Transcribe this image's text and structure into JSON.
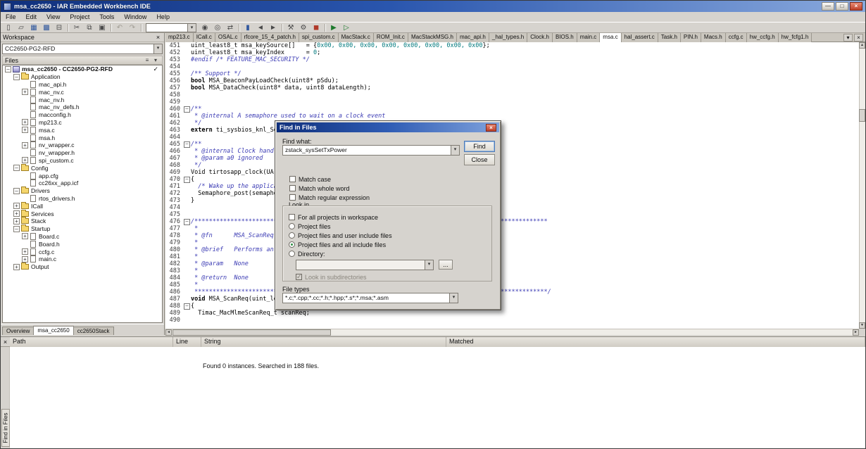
{
  "window": {
    "title": "msa_cc2650 - IAR Embedded Workbench IDE",
    "controls": {
      "minimize": "—",
      "maximize": "□",
      "close": "×"
    }
  },
  "icons": {
    "combo_arrow": "▾",
    "check": "✓",
    "up": "▲",
    "down": "▼",
    "left": "◄",
    "right": "►"
  },
  "menu": {
    "items": [
      "File",
      "Edit",
      "View",
      "Project",
      "Tools",
      "Window",
      "Help"
    ]
  },
  "toolbar": [
    {
      "name": "new-document-icon",
      "glyph": "▯"
    },
    {
      "name": "open-document-icon",
      "glyph": "▱"
    },
    {
      "name": "save-icon",
      "glyph": "▦",
      "cls": "blue"
    },
    {
      "name": "save-all-icon",
      "glyph": "▩",
      "cls": "blue"
    },
    {
      "name": "print-icon",
      "glyph": "⊟"
    },
    {
      "sep": true
    },
    {
      "name": "cut-icon",
      "glyph": "✂"
    },
    {
      "name": "copy-icon",
      "glyph": "⧉"
    },
    {
      "name": "paste-icon",
      "glyph": "▣"
    },
    {
      "sep": true
    },
    {
      "name": "undo-icon",
      "glyph": "↶",
      "cls": "dis"
    },
    {
      "name": "redo-icon",
      "glyph": "↷",
      "cls": "dis"
    },
    {
      "sep": true
    },
    {
      "combo": true,
      "name": "quick-search-combo"
    },
    {
      "name": "find-icon",
      "glyph": "◉"
    },
    {
      "name": "find-next-icon",
      "glyph": "◎"
    },
    {
      "name": "replace-icon",
      "glyph": "⇄"
    },
    {
      "sep": true
    },
    {
      "name": "toggle-bookmark-icon",
      "glyph": "▮",
      "cls": "blue"
    },
    {
      "name": "previous-bookmark-icon",
      "glyph": "◄"
    },
    {
      "name": "next-bookmark-icon",
      "glyph": "►"
    },
    {
      "sep": true
    },
    {
      "name": "make-icon",
      "glyph": "⚒"
    },
    {
      "name": "compile-icon",
      "glyph": "⚙"
    },
    {
      "name": "stop-build-icon",
      "glyph": "◼",
      "cls": "red"
    },
    {
      "sep": true
    },
    {
      "name": "download-and-debug-icon",
      "glyph": "▶",
      "cls": "green"
    },
    {
      "name": "debug-without-downloading-icon",
      "glyph": "▷",
      "cls": "green"
    }
  ],
  "workspace": {
    "title": "Workspace",
    "close_button": "×",
    "config_selector": "CC2650-PG2-RFD",
    "files_header": "Files",
    "files_buttons": [
      {
        "name": "files-sort-icon",
        "glyph": "≡"
      },
      {
        "name": "files-columns-icon",
        "glyph": "▾"
      }
    ],
    "tree": [
      {
        "label": "msa_cc2650 - CC2650-PG2-RFD",
        "depth": 0,
        "kind": "project",
        "exp": "-",
        "check": true
      },
      {
        "label": "Application",
        "depth": 1,
        "kind": "folder",
        "exp": "-"
      },
      {
        "label": "mac_api.h",
        "depth": 2,
        "kind": "file"
      },
      {
        "label": "mac_nv.c",
        "depth": 2,
        "kind": "file",
        "exp": "+"
      },
      {
        "label": "mac_nv.h",
        "depth": 2,
        "kind": "file"
      },
      {
        "label": "mac_nv_defs.h",
        "depth": 2,
        "kind": "file"
      },
      {
        "label": "macconfig.h",
        "depth": 2,
        "kind": "file"
      },
      {
        "label": "mp213.c",
        "depth": 2,
        "kind": "file",
        "exp": "+"
      },
      {
        "label": "msa.c",
        "depth": 2,
        "kind": "file",
        "exp": "+"
      },
      {
        "label": "msa.h",
        "depth": 2,
        "kind": "file"
      },
      {
        "label": "nv_wrapper.c",
        "depth": 2,
        "kind": "file",
        "exp": "+"
      },
      {
        "label": "nv_wrapper.h",
        "depth": 2,
        "kind": "file"
      },
      {
        "label": "spi_custom.c",
        "depth": 2,
        "kind": "file",
        "exp": "+"
      },
      {
        "label": "Config",
        "depth": 1,
        "kind": "folder",
        "exp": "-"
      },
      {
        "label": "app.cfg",
        "depth": 2,
        "kind": "file"
      },
      {
        "label": "cc26xx_app.icf",
        "depth": 2,
        "kind": "file"
      },
      {
        "label": "Drivers",
        "depth": 1,
        "kind": "folder",
        "exp": "-"
      },
      {
        "label": "rtos_drivers.h",
        "depth": 2,
        "kind": "file"
      },
      {
        "label": "ICall",
        "depth": 1,
        "kind": "folder",
        "exp": "+"
      },
      {
        "label": "Services",
        "depth": 1,
        "kind": "folder",
        "exp": "+"
      },
      {
        "label": "Stack",
        "depth": 1,
        "kind": "folder",
        "exp": "+"
      },
      {
        "label": "Startup",
        "depth": 1,
        "kind": "folder",
        "exp": "-"
      },
      {
        "label": "Board.c",
        "depth": 2,
        "kind": "file",
        "exp": "+"
      },
      {
        "label": "Board.h",
        "depth": 2,
        "kind": "file"
      },
      {
        "label": "ccfg.c",
        "depth": 2,
        "kind": "file",
        "exp": "+"
      },
      {
        "label": "main.c",
        "depth": 2,
        "kind": "file",
        "exp": "+"
      },
      {
        "label": "Output",
        "depth": 1,
        "kind": "folder",
        "exp": "+"
      }
    ],
    "tabs": [
      "Overview",
      "msa_cc2650",
      "cc2650Stack"
    ],
    "active_tab": "msa_cc2650"
  },
  "editor": {
    "tabs": [
      "mp213.c",
      "ICall.c",
      "OSAL.c",
      "rfcore_15_4_patch.h",
      "spi_custom.c",
      "MacStack.c",
      "ROM_Init.c",
      "MacStackMSG.h",
      "mac_api.h",
      "_hal_types.h",
      "Clock.h",
      "BIOS.h",
      "main.c",
      "msa.c",
      "hal_assert.c",
      "Task.h",
      "PIN.h",
      "Macs.h",
      "ccfg.c",
      "hw_ccfg.h",
      "hw_fcfg1.h"
    ],
    "active_tab": "msa.c",
    "tab_list_button": "▾",
    "tab_close_button": "×",
    "lines": [
      {
        "n": 451,
        "f": false,
        "s": [
          [
            "uint_least8_t msa_keySource[]   = {",
            "d"
          ],
          [
            "0x00, 0x00, 0x00, 0x00, 0x00, 0x00, 0x00, 0x00",
            "n"
          ],
          [
            "};",
            "d"
          ]
        ]
      },
      {
        "n": 452,
        "f": false,
        "s": [
          [
            "uint_least8_t msa_keyIndex      = ",
            "d"
          ],
          [
            "0",
            "n"
          ],
          [
            ";",
            "d"
          ]
        ]
      },
      {
        "n": 453,
        "f": false,
        "s": [
          [
            "#endif ",
            "pp"
          ],
          [
            "/* FEATURE_MAC_SECURITY */",
            "c"
          ]
        ]
      },
      {
        "n": 454,
        "f": false,
        "s": []
      },
      {
        "n": 455,
        "f": false,
        "s": [
          [
            "/** Support */",
            "c"
          ]
        ]
      },
      {
        "n": 456,
        "f": false,
        "s": [
          [
            "bool",
            "k"
          ],
          [
            " MSA_BeaconPayLoadCheck(uint8* pSdu);",
            "d"
          ]
        ]
      },
      {
        "n": 457,
        "f": false,
        "s": [
          [
            "bool",
            "k"
          ],
          [
            " MSA_DataCheck(uint8* data, uint8 dataLength);",
            "d"
          ]
        ]
      },
      {
        "n": 458,
        "f": false,
        "s": []
      },
      {
        "n": 459,
        "f": false,
        "s": []
      },
      {
        "n": 460,
        "f": true,
        "s": [
          [
            "/**",
            "c"
          ]
        ]
      },
      {
        "n": 461,
        "f": false,
        "s": [
          [
            " * @internal A semaphore used to wait on a clock event",
            "c"
          ]
        ]
      },
      {
        "n": 462,
        "f": false,
        "s": [
          [
            " */",
            "c"
          ]
        ]
      },
      {
        "n": 463,
        "f": false,
        "s": [
          [
            "extern",
            "k"
          ],
          [
            " ti_sysbios_knl_Semaphore_Handle semaphore0;",
            "d"
          ]
        ]
      },
      {
        "n": 464,
        "f": false,
        "s": []
      },
      {
        "n": 465,
        "f": true,
        "s": [
          [
            "/**",
            "c"
          ]
        ]
      },
      {
        "n": 466,
        "f": false,
        "s": [
          [
            " * @internal Clock handler function",
            "c"
          ]
        ]
      },
      {
        "n": 467,
        "f": false,
        "s": [
          [
            " * @param a0 ignored",
            "c"
          ]
        ]
      },
      {
        "n": 468,
        "f": false,
        "s": [
          [
            " */",
            "c"
          ]
        ]
      },
      {
        "n": 469,
        "f": false,
        "s": [
          [
            "Void tirtosapp_clock(UArg a0)",
            "d"
          ]
        ]
      },
      {
        "n": 470,
        "f": true,
        "s": [
          [
            "{",
            "d"
          ]
        ]
      },
      {
        "n": 471,
        "f": false,
        "s": [
          [
            "  ",
            "d"
          ],
          [
            "/* Wake up the application */",
            "c"
          ]
        ]
      },
      {
        "n": 472,
        "f": false,
        "s": [
          [
            "  Semaphore_post(semaphore0);",
            "d"
          ]
        ]
      },
      {
        "n": 473,
        "f": false,
        "s": [
          [
            "}",
            "d"
          ]
        ]
      },
      {
        "n": 474,
        "f": false,
        "s": []
      },
      {
        "n": 475,
        "f": false,
        "s": []
      },
      {
        "n": 476,
        "f": true,
        "s": [
          [
            "/**************************************************************************************************",
            "c"
          ]
        ]
      },
      {
        "n": 477,
        "f": false,
        "s": [
          [
            " *",
            "c"
          ]
        ]
      },
      {
        "n": 478,
        "f": false,
        "s": [
          [
            " * @fn      MSA_ScanReq()",
            "c"
          ]
        ]
      },
      {
        "n": 479,
        "f": false,
        "s": [
          [
            " *",
            "c"
          ]
        ]
      },
      {
        "n": 480,
        "f": false,
        "s": [
          [
            " * @brief   Performs an active scan",
            "c"
          ]
        ]
      },
      {
        "n": 481,
        "f": false,
        "s": [
          [
            " *",
            "c"
          ]
        ]
      },
      {
        "n": 482,
        "f": false,
        "s": [
          [
            " * @param   None",
            "c"
          ]
        ]
      },
      {
        "n": 483,
        "f": false,
        "s": [
          [
            " *",
            "c"
          ]
        ]
      },
      {
        "n": 484,
        "f": false,
        "s": [
          [
            " * @return  None",
            "c"
          ]
        ]
      },
      {
        "n": 485,
        "f": false,
        "s": [
          [
            " *",
            "c"
          ]
        ]
      },
      {
        "n": 486,
        "f": false,
        "s": [
          [
            " **************************************************************************************************/",
            "c"
          ]
        ]
      },
      {
        "n": 487,
        "f": false,
        "s": [
          [
            "void",
            "k"
          ],
          [
            " MSA_ScanReq(uint_least8_t scanType)",
            "d"
          ]
        ]
      },
      {
        "n": 488,
        "f": true,
        "s": [
          [
            "{",
            "d"
          ]
        ]
      },
      {
        "n": 489,
        "f": false,
        "s": [
          [
            "  Timac_MacMlmeScanReq_t scanReq;",
            "d"
          ]
        ]
      },
      {
        "n": 490,
        "f": false,
        "s": []
      }
    ]
  },
  "dialog": {
    "title": "Find in Files",
    "close": "×",
    "find_what_label": "Find what:",
    "find_value": "zstack_sysSetTxPower",
    "find_button": "Find",
    "close_button": "Close",
    "match_options": [
      {
        "label": "Match case",
        "checked": false
      },
      {
        "label": "Match whole word",
        "checked": false
      },
      {
        "label": "Match regular expression",
        "checked": false
      }
    ],
    "look_in": {
      "label": "Look in",
      "options": [
        {
          "kind": "checkbox",
          "label": "For all projects in workspace",
          "checked": false
        },
        {
          "kind": "radio",
          "label": "Project files",
          "checked": false
        },
        {
          "kind": "radio",
          "label": "Project files and user include files",
          "checked": false
        },
        {
          "kind": "radio",
          "label": "Project files and all include files",
          "checked": true
        },
        {
          "kind": "radio",
          "label": "Directory:",
          "checked": false
        }
      ],
      "directory_value": "",
      "browse_button": "...",
      "subdirectories": {
        "label": "Look in subdirectories",
        "checked": true,
        "disabled": true
      }
    },
    "file_types_label": "File types",
    "file_types_value": "*.c;*.cpp;*.cc;*.h;*.hpp;*.s*;*.msa;*.asm"
  },
  "results": {
    "panel_close": "×",
    "columns": [
      "Path",
      "Line",
      "String",
      "Matched"
    ],
    "message": "Found 0 instances. Searched in 188 files.",
    "side_tab": "Find in Files"
  }
}
